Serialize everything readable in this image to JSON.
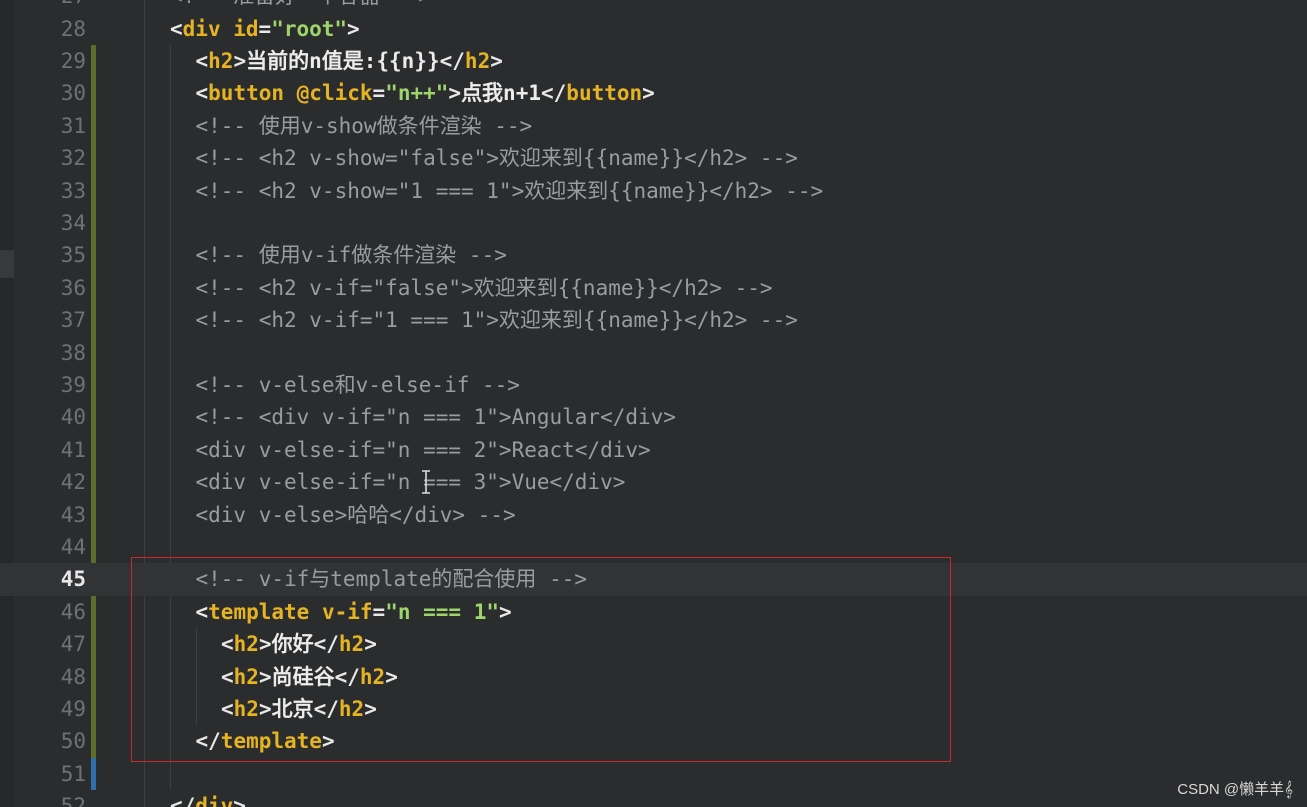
{
  "editor": {
    "lines": [
      {
        "n": "27",
        "indent": 2,
        "tokens": [
          {
            "t": "<!-- 准备好一个容器 -->",
            "c": "comment"
          }
        ]
      },
      {
        "n": "28",
        "indent": 2,
        "tokens": [
          {
            "t": "<",
            "c": "punct"
          },
          {
            "t": "div",
            "c": "tag"
          },
          {
            "t": " id",
            "c": "attr"
          },
          {
            "t": "=",
            "c": "punct"
          },
          {
            "t": "\"root\"",
            "c": "str"
          },
          {
            "t": ">",
            "c": "punct"
          }
        ]
      },
      {
        "n": "29",
        "indent": 3,
        "tokens": [
          {
            "t": "<",
            "c": "punct"
          },
          {
            "t": "h2",
            "c": "tag"
          },
          {
            "t": ">",
            "c": "punct"
          },
          {
            "t": "当前的n值是:{{n}}",
            "c": "plain"
          },
          {
            "t": "</",
            "c": "punct"
          },
          {
            "t": "h2",
            "c": "tag"
          },
          {
            "t": ">",
            "c": "punct"
          }
        ]
      },
      {
        "n": "30",
        "indent": 3,
        "tokens": [
          {
            "t": "<",
            "c": "punct"
          },
          {
            "t": "button",
            "c": "tag"
          },
          {
            "t": " @click",
            "c": "attr"
          },
          {
            "t": "=",
            "c": "punct"
          },
          {
            "t": "\"n++\"",
            "c": "str"
          },
          {
            "t": ">",
            "c": "punct"
          },
          {
            "t": "点我n+1",
            "c": "plain"
          },
          {
            "t": "</",
            "c": "punct"
          },
          {
            "t": "button",
            "c": "tag"
          },
          {
            "t": ">",
            "c": "punct"
          }
        ]
      },
      {
        "n": "31",
        "indent": 3,
        "tokens": [
          {
            "t": "<!-- 使用v-show做条件渲染 -->",
            "c": "comment"
          }
        ]
      },
      {
        "n": "32",
        "indent": 3,
        "tokens": [
          {
            "t": "<!-- <h2 v-show=\"false\">欢迎来到{{name}}</h2> -->",
            "c": "comment"
          }
        ]
      },
      {
        "n": "33",
        "indent": 3,
        "tokens": [
          {
            "t": "<!-- <h2 v-show=\"1 === 1\">欢迎来到{{name}}</h2> -->",
            "c": "comment"
          }
        ]
      },
      {
        "n": "34",
        "indent": 3,
        "tokens": []
      },
      {
        "n": "35",
        "indent": 3,
        "tokens": [
          {
            "t": "<!-- 使用v-if做条件渲染 -->",
            "c": "comment"
          }
        ]
      },
      {
        "n": "36",
        "indent": 3,
        "tokens": [
          {
            "t": "<!-- <h2 v-if=\"false\">欢迎来到{{name}}</h2> -->",
            "c": "comment"
          }
        ]
      },
      {
        "n": "37",
        "indent": 3,
        "tokens": [
          {
            "t": "<!-- <h2 v-if=\"1 === 1\">欢迎来到{{name}}</h2> -->",
            "c": "comment"
          }
        ]
      },
      {
        "n": "38",
        "indent": 3,
        "tokens": []
      },
      {
        "n": "39",
        "indent": 3,
        "tokens": [
          {
            "t": "<!-- v-else和v-else-if -->",
            "c": "comment"
          }
        ]
      },
      {
        "n": "40",
        "indent": 3,
        "tokens": [
          {
            "t": "<!-- <div v-if=\"n === 1\">Angular</div>",
            "c": "comment"
          }
        ]
      },
      {
        "n": "41",
        "indent": 3,
        "tokens": [
          {
            "t": "<div v-else-if=\"n === 2\">React</div>",
            "c": "comment"
          }
        ]
      },
      {
        "n": "42",
        "indent": 3,
        "tokens": [
          {
            "t": "<div v-else-if=\"n === 3\">Vue</div>",
            "c": "comment"
          }
        ]
      },
      {
        "n": "43",
        "indent": 3,
        "tokens": [
          {
            "t": "<div v-else>哈哈</div> -->",
            "c": "comment"
          }
        ]
      },
      {
        "n": "44",
        "indent": 3,
        "tokens": []
      },
      {
        "n": "45",
        "indent": 3,
        "current": true,
        "tokens": [
          {
            "t": "<!-- v-if与template的配合使用 -->",
            "c": "comment"
          }
        ]
      },
      {
        "n": "46",
        "indent": 3,
        "tokens": [
          {
            "t": "<",
            "c": "punct"
          },
          {
            "t": "template",
            "c": "tag"
          },
          {
            "t": " v-if",
            "c": "attr"
          },
          {
            "t": "=",
            "c": "punct"
          },
          {
            "t": "\"n === 1\"",
            "c": "str"
          },
          {
            "t": ">",
            "c": "punct"
          }
        ]
      },
      {
        "n": "47",
        "indent": 4,
        "tokens": [
          {
            "t": "<",
            "c": "punct"
          },
          {
            "t": "h2",
            "c": "tag"
          },
          {
            "t": ">",
            "c": "punct"
          },
          {
            "t": "你好",
            "c": "plain"
          },
          {
            "t": "</",
            "c": "punct"
          },
          {
            "t": "h2",
            "c": "tag"
          },
          {
            "t": ">",
            "c": "punct"
          }
        ]
      },
      {
        "n": "48",
        "indent": 4,
        "tokens": [
          {
            "t": "<",
            "c": "punct"
          },
          {
            "t": "h2",
            "c": "tag"
          },
          {
            "t": ">",
            "c": "punct"
          },
          {
            "t": "尚硅谷",
            "c": "plain"
          },
          {
            "t": "</",
            "c": "punct"
          },
          {
            "t": "h2",
            "c": "tag"
          },
          {
            "t": ">",
            "c": "punct"
          }
        ]
      },
      {
        "n": "49",
        "indent": 4,
        "tokens": [
          {
            "t": "<",
            "c": "punct"
          },
          {
            "t": "h2",
            "c": "tag"
          },
          {
            "t": ">",
            "c": "punct"
          },
          {
            "t": "北京",
            "c": "plain"
          },
          {
            "t": "</",
            "c": "punct"
          },
          {
            "t": "h2",
            "c": "tag"
          },
          {
            "t": ">",
            "c": "punct"
          }
        ]
      },
      {
        "n": "50",
        "indent": 3,
        "tokens": [
          {
            "t": "</",
            "c": "punct"
          },
          {
            "t": "template",
            "c": "tag"
          },
          {
            "t": ">",
            "c": "punct"
          }
        ]
      },
      {
        "n": "51",
        "indent": 3,
        "tokens": []
      },
      {
        "n": "52",
        "indent": 2,
        "tokens": [
          {
            "t": "</",
            "c": "punct"
          },
          {
            "t": "div",
            "c": "tag"
          },
          {
            "t": ">",
            "c": "punct"
          }
        ]
      }
    ],
    "current_line": "45",
    "colors": {
      "background": "#2b2c2d",
      "tag": "#e6b422",
      "string": "#9ed56b",
      "comment": "#9a9c9e",
      "highlight_box": "#c8282e"
    }
  },
  "watermark": {
    "text": "CSDN @懒羊羊𝄞"
  }
}
